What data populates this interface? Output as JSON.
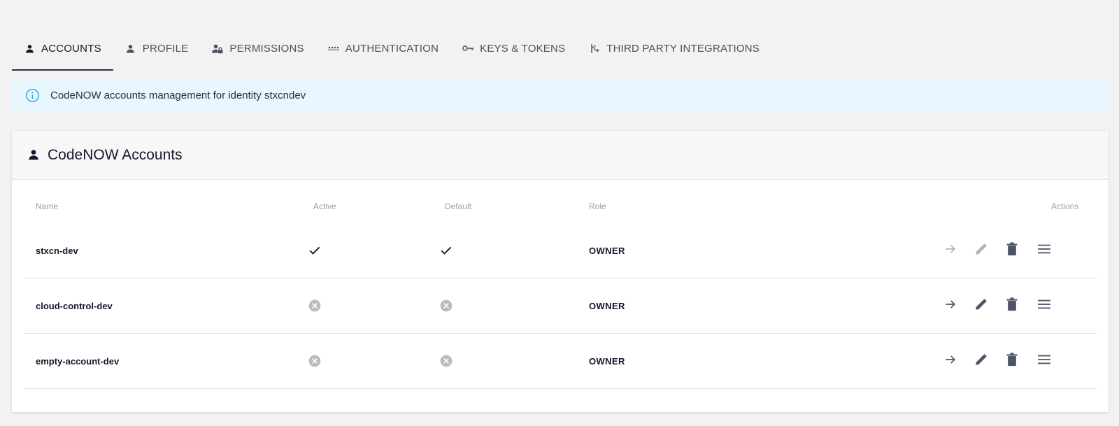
{
  "tabs": [
    {
      "label": "ACCOUNTS",
      "icon": "person-icon",
      "active": true
    },
    {
      "label": "PROFILE",
      "icon": "person-icon",
      "active": false
    },
    {
      "label": "PERMISSIONS",
      "icon": "people-lock-icon",
      "active": false
    },
    {
      "label": "AUTHENTICATION",
      "icon": "password-dots-icon",
      "active": false
    },
    {
      "label": "KEYS & TOKENS",
      "icon": "key-icon",
      "active": false
    },
    {
      "label": "THIRD PARTY INTEGRATIONS",
      "icon": "integration-icon",
      "active": false
    }
  ],
  "info": {
    "text": "CodeNOW accounts management for identity stxcndev"
  },
  "card": {
    "title": "CodeNOW Accounts",
    "columns": {
      "name": "Name",
      "active": "Active",
      "default": "Default",
      "role": "Role",
      "actions": "Actions"
    },
    "rows": [
      {
        "name": "stxcn-dev",
        "active": true,
        "default": true,
        "role": "OWNER",
        "actions_enabled": false
      },
      {
        "name": "cloud-control-dev",
        "active": false,
        "default": false,
        "role": "OWNER",
        "actions_enabled": true
      },
      {
        "name": "empty-account-dev",
        "active": false,
        "default": false,
        "role": "OWNER",
        "actions_enabled": true
      }
    ]
  },
  "colors": {
    "accent": "#2b2f45",
    "info_bg": "#e8f6fd",
    "info_icon": "#3aaee0",
    "icon_muted": "#b0b3bb",
    "icon_dark": "#4e5467"
  }
}
